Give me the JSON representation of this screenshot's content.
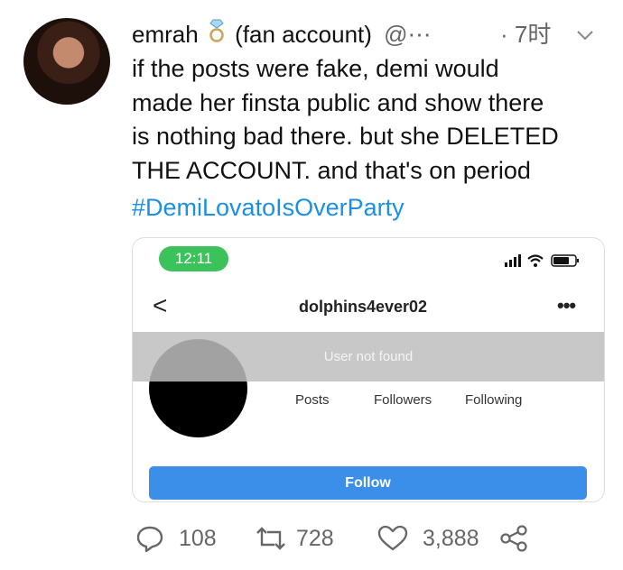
{
  "tweet": {
    "display_name": "emrah",
    "ring_icon": "diamond-ring-icon",
    "name_suffix": "(fan account)",
    "handle": "@⋯",
    "time": "· 7时",
    "caret_icon": "chevron-down-icon",
    "text": "if the posts were fake, demi would\nmade her finsta public and show there\nis nothing bad there. but she DELETED\nTHE ACCOUNT. and that's on period",
    "hashtag": "#DemiLovatoIsOverParty",
    "hashtag_color": "#1b8fe2"
  },
  "card": {
    "status_time": "12:11",
    "status_color": "#3cc25a",
    "back_glyph": "<",
    "username": "dolphins4ever02",
    "more_glyph": "•••",
    "banner": "User not found",
    "stats": {
      "posts_label": "Posts",
      "followers_label": "Followers",
      "following_label": "Following"
    },
    "follow_label": "Follow",
    "follow_color": "#3b8fe8"
  },
  "actions": {
    "replies": "108",
    "retweets": "728",
    "likes": "3,888",
    "icons": [
      "reply-icon",
      "retweet-icon",
      "like-icon",
      "share-icon"
    ]
  }
}
